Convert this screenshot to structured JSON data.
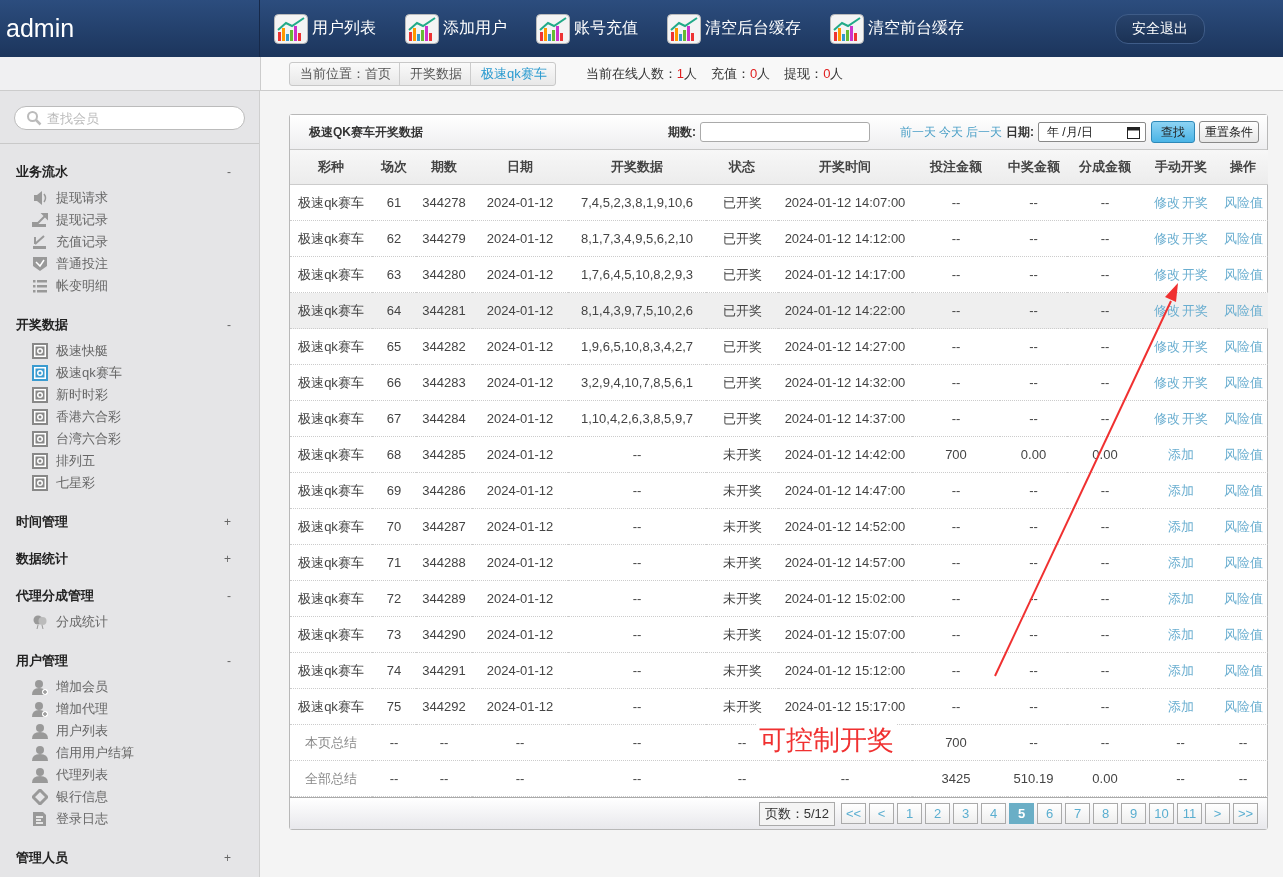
{
  "header": {
    "brand": "admin",
    "nav": [
      {
        "label": "用户列表"
      },
      {
        "label": "添加用户"
      },
      {
        "label": "账号充值"
      },
      {
        "label": "清空后台缓存"
      },
      {
        "label": "清空前台缓存"
      }
    ],
    "logout": "安全退出"
  },
  "breadcrumb": {
    "items": [
      {
        "label": "当前位置：首页",
        "selected": false
      },
      {
        "label": "开奖数据",
        "selected": false
      },
      {
        "label": "极速qk赛车",
        "selected": true
      }
    ],
    "stats": [
      {
        "label": "当前在线人数：",
        "value": "1",
        "unit": "人"
      },
      {
        "label": "充值：",
        "value": "0",
        "unit": "人"
      },
      {
        "label": "提现：",
        "value": "0",
        "unit": "人"
      }
    ]
  },
  "sidebar": {
    "search": {
      "placeholder": "查找会员"
    },
    "sections": [
      {
        "title": "业务流水",
        "toggle": "-",
        "items": [
          {
            "label": "提现请求",
            "kind": "speaker",
            "selected": false
          },
          {
            "label": "提现记录",
            "kind": "up",
            "selected": false
          },
          {
            "label": "充值记录",
            "kind": "down",
            "selected": false
          },
          {
            "label": "普通投注",
            "kind": "shield",
            "selected": false
          },
          {
            "label": "帐变明细",
            "kind": "list",
            "selected": false
          }
        ]
      },
      {
        "title": "开奖数据",
        "toggle": "-",
        "items": [
          {
            "label": "极速快艇",
            "kind": "target",
            "selected": false
          },
          {
            "label": "极速qk赛车",
            "kind": "target",
            "selected": true
          },
          {
            "label": "新时时彩",
            "kind": "target",
            "selected": false
          },
          {
            "label": "香港六合彩",
            "kind": "target",
            "selected": false
          },
          {
            "label": "台湾六合彩",
            "kind": "target",
            "selected": false
          },
          {
            "label": "排列五",
            "kind": "target",
            "selected": false
          },
          {
            "label": "七星彩",
            "kind": "target",
            "selected": false
          }
        ]
      },
      {
        "title": "时间管理",
        "toggle": "+"
      },
      {
        "title": "数据统计",
        "toggle": "+"
      },
      {
        "title": "代理分成管理",
        "toggle": "-",
        "items": [
          {
            "label": "分成统计",
            "kind": "balloon",
            "selected": false
          }
        ]
      },
      {
        "title": "用户管理",
        "toggle": "-",
        "items": [
          {
            "label": "增加会员",
            "kind": "useradd",
            "selected": false
          },
          {
            "label": "增加代理",
            "kind": "useradd",
            "selected": false
          },
          {
            "label": "用户列表",
            "kind": "user",
            "selected": false
          },
          {
            "label": "信用用户结算",
            "kind": "user",
            "selected": false
          },
          {
            "label": "代理列表",
            "kind": "user",
            "selected": false
          },
          {
            "label": "银行信息",
            "kind": "diamond",
            "selected": false
          },
          {
            "label": "登录日志",
            "kind": "doc",
            "selected": false
          }
        ]
      },
      {
        "title": "管理人员",
        "toggle": "+"
      }
    ]
  },
  "panel": {
    "title": "极速QK赛车开奖数据",
    "issue_label": "期数:",
    "day_links": [
      "前一天",
      "今天",
      "后一天"
    ],
    "date_label": "日期:",
    "date_field": {
      "placeholder": "年 /月/日"
    },
    "search_button": "查找",
    "reset_button": "重置条件",
    "table": {
      "columns": [
        "彩种",
        "场次",
        "期数",
        "日期",
        "开奖数据",
        "状态",
        "开奖时间",
        "投注金额",
        "中奖金额",
        "分成金额",
        "手动开奖",
        "操作"
      ],
      "rows": [
        {
          "cells": [
            "极速qk赛车",
            "61",
            "344278",
            "2024-01-12",
            "7,4,5,2,3,8,1,9,10,6",
            "已开奖",
            "2024-01-12 14:07:00",
            "--",
            "--",
            "--"
          ],
          "manual": [
            "修改",
            "开奖"
          ],
          "ops": [
            "风险值"
          ],
          "selected": false
        },
        {
          "cells": [
            "极速qk赛车",
            "62",
            "344279",
            "2024-01-12",
            "8,1,7,3,4,9,5,6,2,10",
            "已开奖",
            "2024-01-12 14:12:00",
            "--",
            "--",
            "--"
          ],
          "manual": [
            "修改",
            "开奖"
          ],
          "ops": [
            "风险值"
          ],
          "selected": false
        },
        {
          "cells": [
            "极速qk赛车",
            "63",
            "344280",
            "2024-01-12",
            "1,7,6,4,5,10,8,2,9,3",
            "已开奖",
            "2024-01-12 14:17:00",
            "--",
            "--",
            "--"
          ],
          "manual": [
            "修改",
            "开奖"
          ],
          "ops": [
            "风险值"
          ],
          "selected": false
        },
        {
          "cells": [
            "极速qk赛车",
            "64",
            "344281",
            "2024-01-12",
            "8,1,4,3,9,7,5,10,2,6",
            "已开奖",
            "2024-01-12 14:22:00",
            "--",
            "--",
            "--"
          ],
          "manual": [
            "修改",
            "开奖"
          ],
          "ops": [
            "风险值"
          ],
          "selected": true
        },
        {
          "cells": [
            "极速qk赛车",
            "65",
            "344282",
            "2024-01-12",
            "1,9,6,5,10,8,3,4,2,7",
            "已开奖",
            "2024-01-12 14:27:00",
            "--",
            "--",
            "--"
          ],
          "manual": [
            "修改",
            "开奖"
          ],
          "ops": [
            "风险值"
          ],
          "selected": false
        },
        {
          "cells": [
            "极速qk赛车",
            "66",
            "344283",
            "2024-01-12",
            "3,2,9,4,10,7,8,5,6,1",
            "已开奖",
            "2024-01-12 14:32:00",
            "--",
            "--",
            "--"
          ],
          "manual": [
            "修改",
            "开奖"
          ],
          "ops": [
            "风险值"
          ],
          "selected": false
        },
        {
          "cells": [
            "极速qk赛车",
            "67",
            "344284",
            "2024-01-12",
            "1,10,4,2,6,3,8,5,9,7",
            "已开奖",
            "2024-01-12 14:37:00",
            "--",
            "--",
            "--"
          ],
          "manual": [
            "修改",
            "开奖"
          ],
          "ops": [
            "风险值"
          ],
          "selected": false
        },
        {
          "cells": [
            "极速qk赛车",
            "68",
            "344285",
            "2024-01-12",
            "--",
            "未开奖",
            "2024-01-12 14:42:00",
            "700",
            "0.00",
            "0.00"
          ],
          "manual": [
            "添加"
          ],
          "ops": [
            "风险值"
          ],
          "selected": false
        },
        {
          "cells": [
            "极速qk赛车",
            "69",
            "344286",
            "2024-01-12",
            "--",
            "未开奖",
            "2024-01-12 14:47:00",
            "--",
            "--",
            "--"
          ],
          "manual": [
            "添加"
          ],
          "ops": [
            "风险值"
          ],
          "selected": false
        },
        {
          "cells": [
            "极速qk赛车",
            "70",
            "344287",
            "2024-01-12",
            "--",
            "未开奖",
            "2024-01-12 14:52:00",
            "--",
            "--",
            "--"
          ],
          "manual": [
            "添加"
          ],
          "ops": [
            "风险值"
          ],
          "selected": false
        },
        {
          "cells": [
            "极速qk赛车",
            "71",
            "344288",
            "2024-01-12",
            "--",
            "未开奖",
            "2024-01-12 14:57:00",
            "--",
            "--",
            "--"
          ],
          "manual": [
            "添加"
          ],
          "ops": [
            "风险值"
          ],
          "selected": false
        },
        {
          "cells": [
            "极速qk赛车",
            "72",
            "344289",
            "2024-01-12",
            "--",
            "未开奖",
            "2024-01-12 15:02:00",
            "--",
            "--",
            "--"
          ],
          "manual": [
            "添加"
          ],
          "ops": [
            "风险值"
          ],
          "selected": false
        },
        {
          "cells": [
            "极速qk赛车",
            "73",
            "344290",
            "2024-01-12",
            "--",
            "未开奖",
            "2024-01-12 15:07:00",
            "--",
            "--",
            "--"
          ],
          "manual": [
            "添加"
          ],
          "ops": [
            "风险值"
          ],
          "selected": false
        },
        {
          "cells": [
            "极速qk赛车",
            "74",
            "344291",
            "2024-01-12",
            "--",
            "未开奖",
            "2024-01-12 15:12:00",
            "--",
            "--",
            "--"
          ],
          "manual": [
            "添加"
          ],
          "ops": [
            "风险值"
          ],
          "selected": false
        },
        {
          "cells": [
            "极速qk赛车",
            "75",
            "344292",
            "2024-01-12",
            "--",
            "未开奖",
            "2024-01-12 15:17:00",
            "--",
            "--",
            "--"
          ],
          "manual": [
            "添加"
          ],
          "ops": [
            "风险值"
          ],
          "selected": false
        }
      ],
      "totals": [
        {
          "cells": [
            "本页总结",
            "--",
            "--",
            "--",
            "--",
            "--",
            null,
            "700",
            "--",
            "--",
            "--",
            "--"
          ]
        },
        {
          "cells": [
            "全部总结",
            "--",
            "--",
            "--",
            "--",
            "--",
            "--",
            "3425",
            "510.19",
            "0.00",
            "--",
            "--"
          ]
        }
      ]
    },
    "pager": {
      "info": "页数：5/12",
      "pages": [
        {
          "label": "<<",
          "selected": false
        },
        {
          "label": "<",
          "selected": false
        },
        {
          "label": "1",
          "selected": false
        },
        {
          "label": "2",
          "selected": false
        },
        {
          "label": "3",
          "selected": false
        },
        {
          "label": "4",
          "selected": false
        },
        {
          "label": "5",
          "selected": true
        },
        {
          "label": "6",
          "selected": false
        },
        {
          "label": "7",
          "selected": false
        },
        {
          "label": "8",
          "selected": false
        },
        {
          "label": "9",
          "selected": false
        },
        {
          "label": "10",
          "selected": false
        },
        {
          "label": "11",
          "selected": false
        },
        {
          "label": ">",
          "selected": false
        },
        {
          "label": ">>",
          "selected": false
        }
      ]
    }
  },
  "annotation": {
    "text": "可控制开奖"
  }
}
